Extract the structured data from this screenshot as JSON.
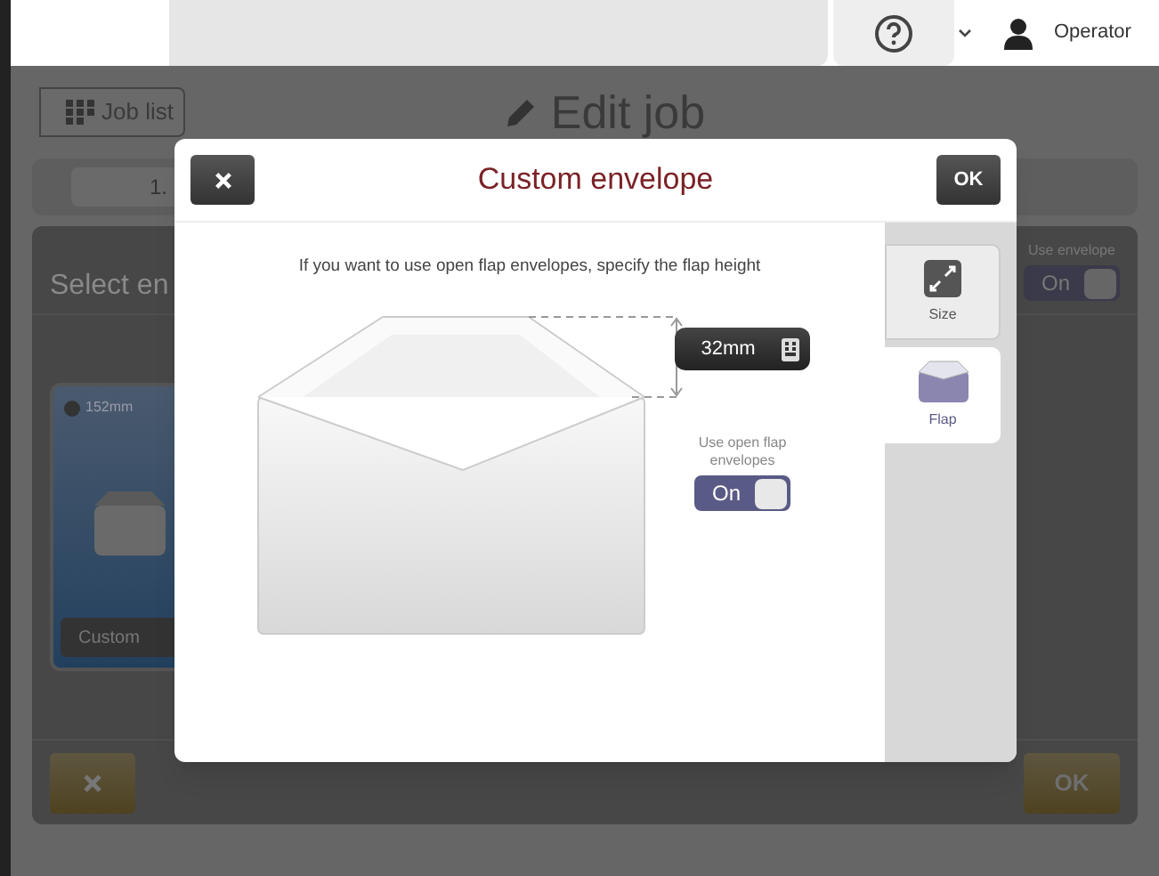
{
  "top_bar": {
    "user": "Operator"
  },
  "background": {
    "back_button": "Job list",
    "title": "Edit job",
    "step": "1.",
    "section_title": "Select en",
    "card": {
      "size": "152mm",
      "button": "Custom",
      "selected": true
    },
    "use_envelope": {
      "label": "Use envelope",
      "value": "On",
      "on": true
    },
    "ok_button": "OK"
  },
  "dialog": {
    "title": "Custom envelope",
    "ok_button": "OK",
    "instruction": "If you want to use open flap envelopes, specify the flap height",
    "flap_height": "32mm",
    "toggle": {
      "label": "Use open flap envelopes",
      "value": "On",
      "on": true
    },
    "tabs": [
      {
        "label": "Size",
        "selected": false
      },
      {
        "label": "Flap",
        "selected": true
      }
    ]
  }
}
